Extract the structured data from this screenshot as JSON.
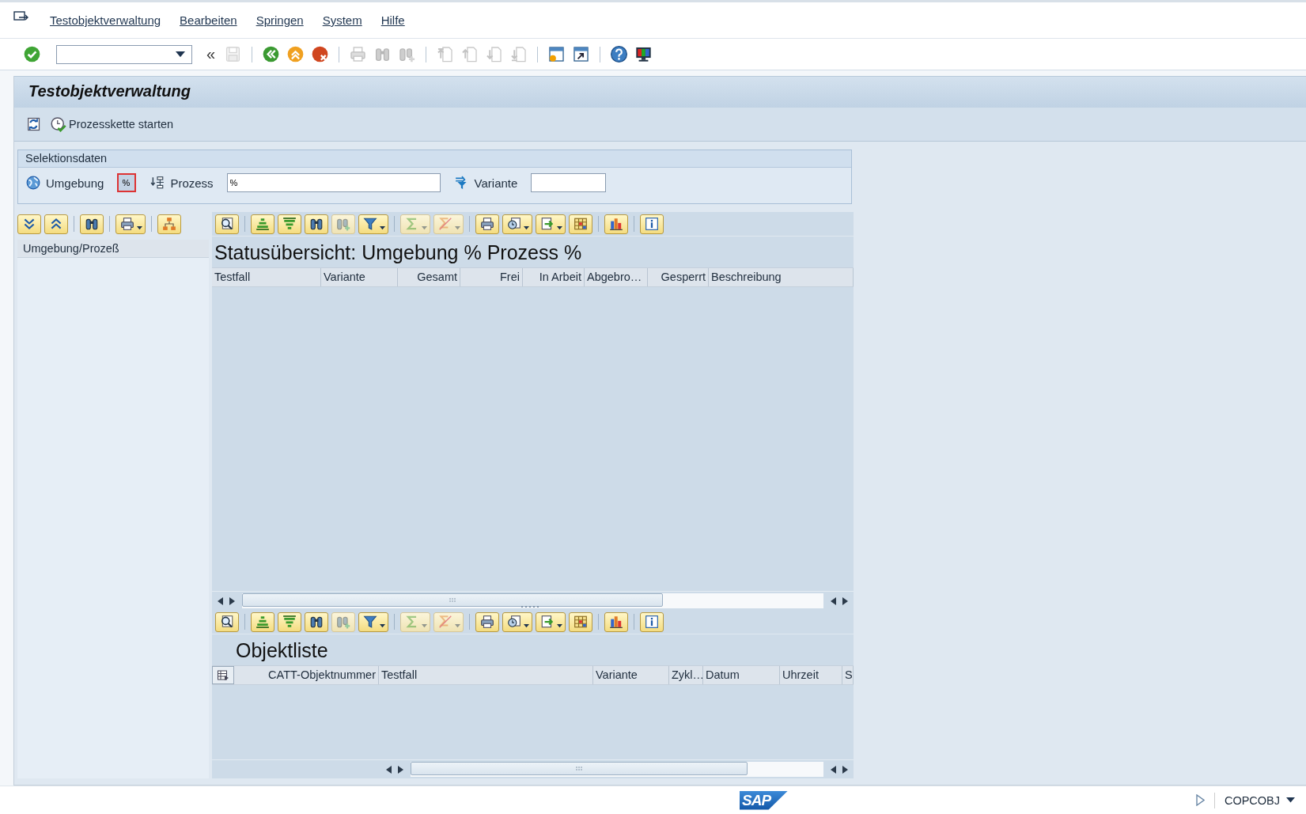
{
  "menu_items": [
    {
      "label": "Testobjektverwaltung"
    },
    {
      "label": "Bearbeiten"
    },
    {
      "label": "Springen"
    },
    {
      "label": "System"
    },
    {
      "label": "Hilfe"
    }
  ],
  "toolbar": [
    {
      "kind": "enter",
      "disabled": false
    },
    {
      "kind": "command-field"
    },
    {
      "kind": "toggle",
      "label": "«"
    },
    {
      "kind": "save",
      "disabled": true
    },
    {
      "kind": "separator"
    },
    {
      "kind": "back",
      "disabled": false
    },
    {
      "kind": "exit",
      "disabled": false
    },
    {
      "kind": "cancel",
      "disabled": false
    },
    {
      "kind": "separator"
    },
    {
      "kind": "print",
      "disabled": true
    },
    {
      "kind": "find",
      "disabled": true
    },
    {
      "kind": "find-next",
      "disabled": true
    },
    {
      "kind": "separator"
    },
    {
      "kind": "first-page",
      "disabled": true
    },
    {
      "kind": "previous-page",
      "disabled": true
    },
    {
      "kind": "next-page",
      "disabled": true
    },
    {
      "kind": "last-page",
      "disabled": true
    },
    {
      "kind": "separator"
    },
    {
      "kind": "new-session",
      "disabled": false
    },
    {
      "kind": "shortcut",
      "disabled": false
    },
    {
      "kind": "separator"
    },
    {
      "kind": "help",
      "disabled": false
    },
    {
      "kind": "customize",
      "disabled": false
    }
  ],
  "title": "Testobjektverwaltung",
  "app_toolbar": [
    {
      "kind": "refresh"
    },
    {
      "kind": "process-chain",
      "label": "Prozesskette starten"
    }
  ],
  "selection": {
    "title": "Selektionsdaten",
    "fields": [
      {
        "kind": "environment",
        "label": "Umgebung",
        "value": "%",
        "focused": true
      },
      {
        "kind": "process",
        "label": "Prozess",
        "value": "%",
        "focused": false
      },
      {
        "kind": "variant",
        "label": "Variante",
        "focused": false
      }
    ]
  },
  "tree": {
    "toolbar": [
      {
        "kind": "expand",
        "menu": false
      },
      {
        "kind": "collapse",
        "menu": false
      },
      {
        "kind": "separator"
      },
      {
        "kind": "find",
        "menu": false
      },
      {
        "kind": "separator"
      },
      {
        "kind": "print",
        "menu": true
      },
      {
        "kind": "separator"
      },
      {
        "kind": "hierarchy",
        "menu": false
      }
    ],
    "header": "Umgebung/Prozeß"
  },
  "grids": [
    {
      "toolbar": [
        {
          "kind": "details",
          "disabled": false,
          "menu": false
        },
        {
          "kind": "separator"
        },
        {
          "kind": "sort-ascending",
          "disabled": false,
          "menu": false
        },
        {
          "kind": "sort-descending",
          "disabled": false,
          "menu": false
        },
        {
          "kind": "find",
          "disabled": false,
          "menu": false
        },
        {
          "kind": "find-next",
          "disabled": true,
          "menu": false
        },
        {
          "kind": "filter",
          "disabled": false,
          "menu": true
        },
        {
          "kind": "separator"
        },
        {
          "kind": "sum",
          "disabled": true,
          "menu": true
        },
        {
          "kind": "subtotals",
          "disabled": true,
          "menu": true
        },
        {
          "kind": "separator"
        },
        {
          "kind": "print",
          "disabled": false,
          "menu": false
        },
        {
          "kind": "views",
          "disabled": false,
          "menu": true
        },
        {
          "kind": "export",
          "disabled": false,
          "menu": true
        },
        {
          "kind": "layout",
          "disabled": false,
          "menu": false
        },
        {
          "kind": "separator"
        },
        {
          "kind": "graphic",
          "disabled": false,
          "menu": false
        },
        {
          "kind": "separator"
        },
        {
          "kind": "info",
          "disabled": false,
          "menu": false
        }
      ],
      "title": "Statusübersicht: Umgebung % Prozess %",
      "columns": [
        {
          "kind": "text",
          "label": "Testfall"
        },
        {
          "kind": "text",
          "label": "Variante"
        },
        {
          "kind": "number",
          "label": "Gesamt"
        },
        {
          "kind": "number",
          "label": "Frei"
        },
        {
          "kind": "number",
          "label": "In Arbeit"
        },
        {
          "kind": "text",
          "label": "Abgebro…"
        },
        {
          "kind": "number",
          "label": "Gesperrt"
        },
        {
          "kind": "text",
          "label": "Beschreibung"
        }
      ]
    },
    {
      "toolbar": [
        {
          "kind": "details",
          "disabled": false,
          "menu": false
        },
        {
          "kind": "separator"
        },
        {
          "kind": "sort-ascending",
          "disabled": false,
          "menu": false
        },
        {
          "kind": "sort-descending",
          "disabled": false,
          "menu": false
        },
        {
          "kind": "find",
          "disabled": false,
          "menu": false
        },
        {
          "kind": "find-next",
          "disabled": true,
          "menu": false
        },
        {
          "kind": "filter",
          "disabled": false,
          "menu": true
        },
        {
          "kind": "separator"
        },
        {
          "kind": "sum",
          "disabled": true,
          "menu": true
        },
        {
          "kind": "subtotals",
          "disabled": true,
          "menu": true
        },
        {
          "kind": "separator"
        },
        {
          "kind": "print",
          "disabled": false,
          "menu": false
        },
        {
          "kind": "views",
          "disabled": false,
          "menu": true
        },
        {
          "kind": "export",
          "disabled": false,
          "menu": true
        },
        {
          "kind": "layout",
          "disabled": false,
          "menu": false
        },
        {
          "kind": "separator"
        },
        {
          "kind": "graphic",
          "disabled": false,
          "menu": false
        },
        {
          "kind": "separator"
        },
        {
          "kind": "info",
          "disabled": false,
          "menu": false
        }
      ],
      "title": "Objektliste",
      "columns": [
        {
          "kind": "select-all"
        },
        {
          "kind": "number",
          "label": "CATT-Objektnummer"
        },
        {
          "kind": "text",
          "label": "Testfall"
        },
        {
          "kind": "text",
          "label": "Variante"
        },
        {
          "kind": "text",
          "label": "Zykl…"
        },
        {
          "kind": "text",
          "label": "Datum"
        },
        {
          "kind": "text",
          "label": "Uhrzeit"
        },
        {
          "kind": "text",
          "label": "S"
        }
      ]
    }
  ],
  "status_bar": {
    "logo": "SAP",
    "transaction": "COPCOBJ"
  }
}
